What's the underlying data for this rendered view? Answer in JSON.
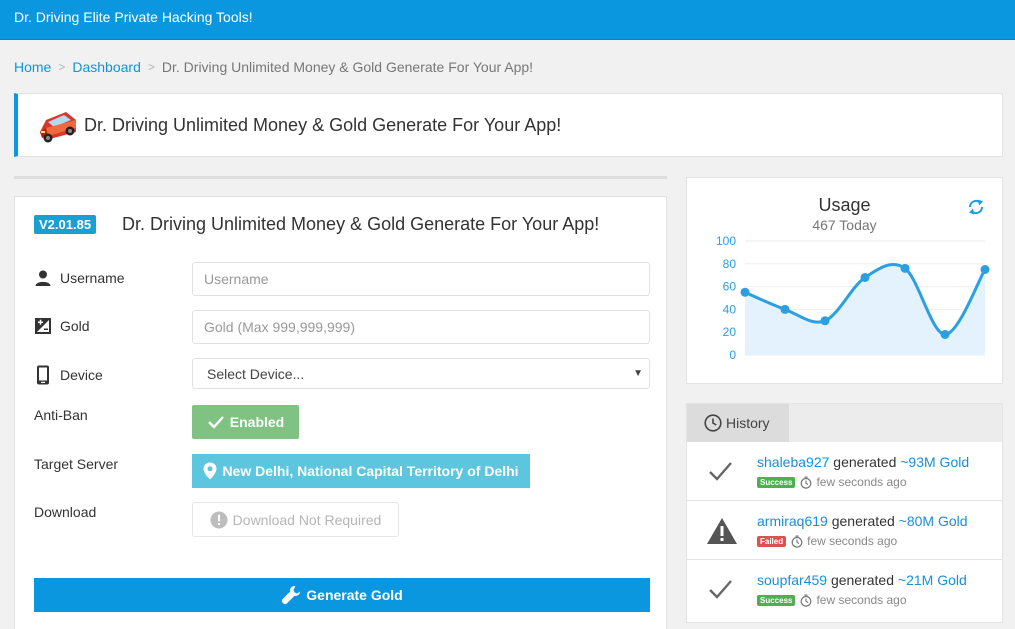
{
  "header": {
    "brand": "Dr. Driving Elite Private Hacking Tools!"
  },
  "breadcrumb": {
    "home": "Home",
    "dashboard": "Dashboard",
    "current": "Dr. Driving Unlimited Money & Gold Generate For Your App!"
  },
  "title_box": {
    "title": "Dr. Driving Unlimited Money & Gold Generate For Your App!"
  },
  "form": {
    "version": "V2.01.85",
    "title": "Dr. Driving Unlimited Money & Gold Generate For Your App!",
    "username_label": "Username",
    "username_placeholder": "Username",
    "gold_label": "Gold",
    "gold_placeholder": "Gold (Max 999,999,999)",
    "device_label": "Device",
    "device_value": "Select Device...",
    "antiban_label": "Anti-Ban",
    "antiban_value": "Enabled",
    "server_label": "Target Server",
    "server_value": "New Delhi, National Capital Territory of Delhi",
    "download_label": "Download",
    "download_value": "Download Not Required",
    "generate_label": "Generate Gold"
  },
  "usage": {
    "title": "Usage",
    "subtitle": "467 Today"
  },
  "chart_data": {
    "type": "area",
    "x": [
      0,
      1,
      2,
      3,
      4,
      5,
      6
    ],
    "values": [
      55,
      40,
      30,
      68,
      76,
      18,
      75
    ],
    "yticks": [
      "100",
      "80",
      "60",
      "40",
      "20",
      "0"
    ],
    "ylim": [
      0,
      100
    ],
    "color": "#2b9fe0"
  },
  "history": {
    "tab_label": "History",
    "generated_word": "generated",
    "items": [
      {
        "user": "shaleba927",
        "amount": "~93M Gold",
        "status": "Success",
        "time": "few seconds ago"
      },
      {
        "user": "armiraq619",
        "amount": "~80M Gold",
        "status": "Failed",
        "time": "few seconds ago"
      },
      {
        "user": "soupfar459",
        "amount": "~21M Gold",
        "status": "Success",
        "time": "few seconds ago"
      }
    ]
  }
}
